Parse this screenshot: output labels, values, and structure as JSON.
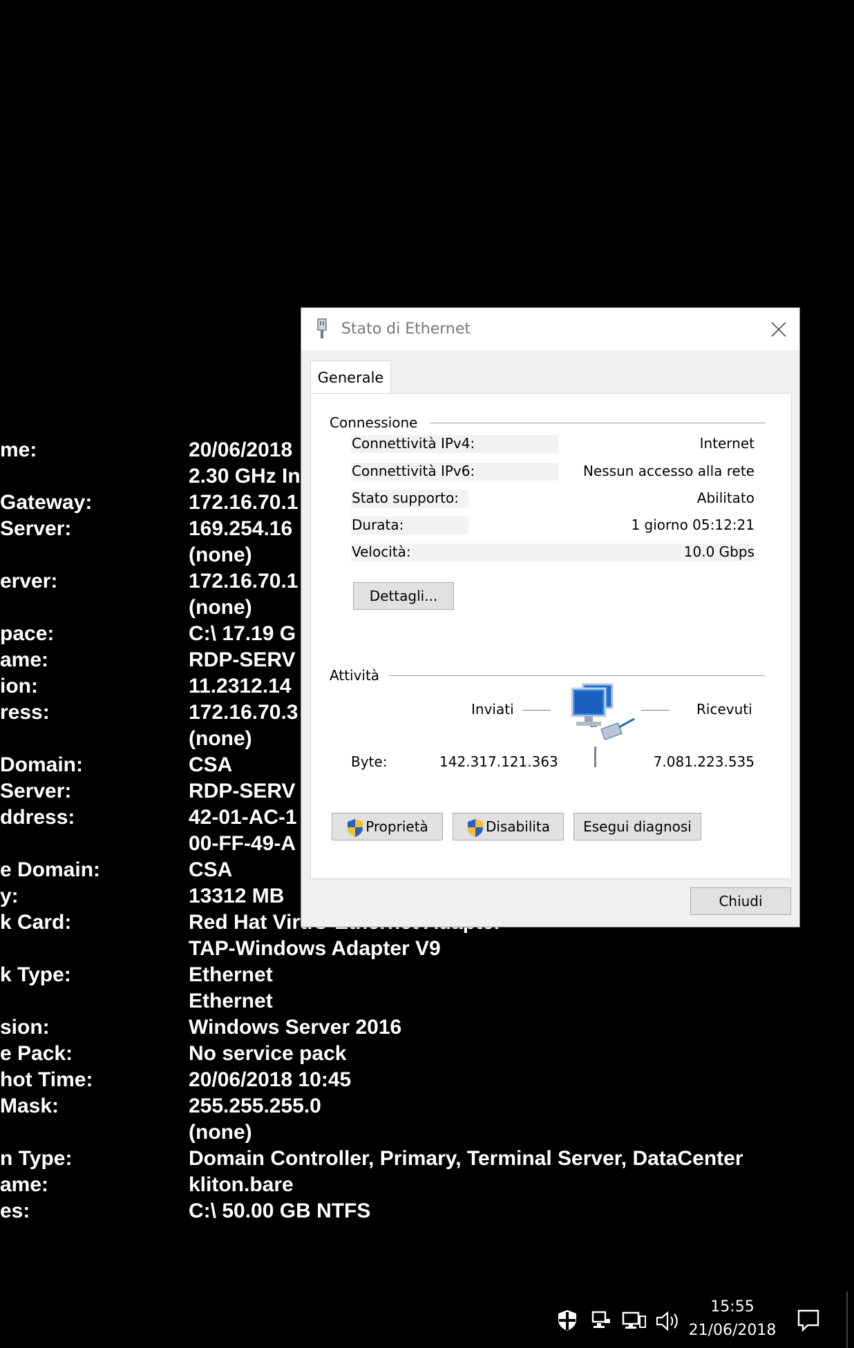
{
  "desktop": {
    "labels": [
      "me:",
      "",
      "Gateway:",
      "Server:",
      "",
      "erver:",
      "",
      "pace:",
      "ame:",
      "ion:",
      "ress:",
      "",
      "Domain:",
      "Server:",
      "ddress:",
      "",
      "e Domain:",
      "y:",
      "k Card:",
      "",
      "k Type:",
      "",
      "sion:",
      "e Pack:",
      "hot Time:",
      "Mask:",
      "",
      "n Type:",
      "ame:",
      "es:"
    ],
    "values": [
      "20/06/2018",
      "2.30 GHz In",
      "172.16.70.1",
      "169.254.16",
      "(none)",
      "172.16.70.1",
      "(none)",
      "C:\\ 17.19 G",
      "RDP-SERV",
      "11.2312.14",
      "172.16.70.3",
      "(none)",
      "CSA",
      "RDP-SERV",
      "42-01-AC-1",
      "00-FF-49-A",
      "CSA",
      "13312 MB",
      "Red Hat VirtIO Ethernet Adapter",
      "TAP-Windows Adapter V9",
      "Ethernet",
      "Ethernet",
      "Windows Server 2016",
      "No service pack",
      "20/06/2018 10:45",
      "255.255.255.0",
      "(none)",
      "Domain Controller, Primary, Terminal Server, DataCenter",
      "kliton.bare",
      "C:\\ 50.00 GB NTFS"
    ]
  },
  "dialog": {
    "title": "Stato di Ethernet",
    "tab": "Generale",
    "connection": {
      "section": "Connessione",
      "rows": [
        {
          "label": "Connettività IPv4:",
          "value": "Internet"
        },
        {
          "label": "Connettività IPv6:",
          "value": "Nessun accesso alla rete"
        },
        {
          "label": "Stato supporto:",
          "value": "Abilitato"
        },
        {
          "label": "Durata:",
          "value": "1 giorno 05:12:21"
        },
        {
          "label": "Velocità:",
          "value": "10.0 Gbps"
        }
      ],
      "details_button": "Dettagli..."
    },
    "activity": {
      "section": "Attività",
      "sent_label": "Inviati",
      "received_label": "Ricevuti",
      "bytes_label": "Byte:",
      "bytes_sent": "142.317.121.363",
      "bytes_received": "7.081.223.535"
    },
    "buttons": {
      "properties": "Proprietà",
      "disable": "Disabilita",
      "diagnose": "Esegui diagnosi",
      "close": "Chiudi"
    }
  },
  "taskbar": {
    "time": "15:55",
    "date": "21/06/2018"
  }
}
